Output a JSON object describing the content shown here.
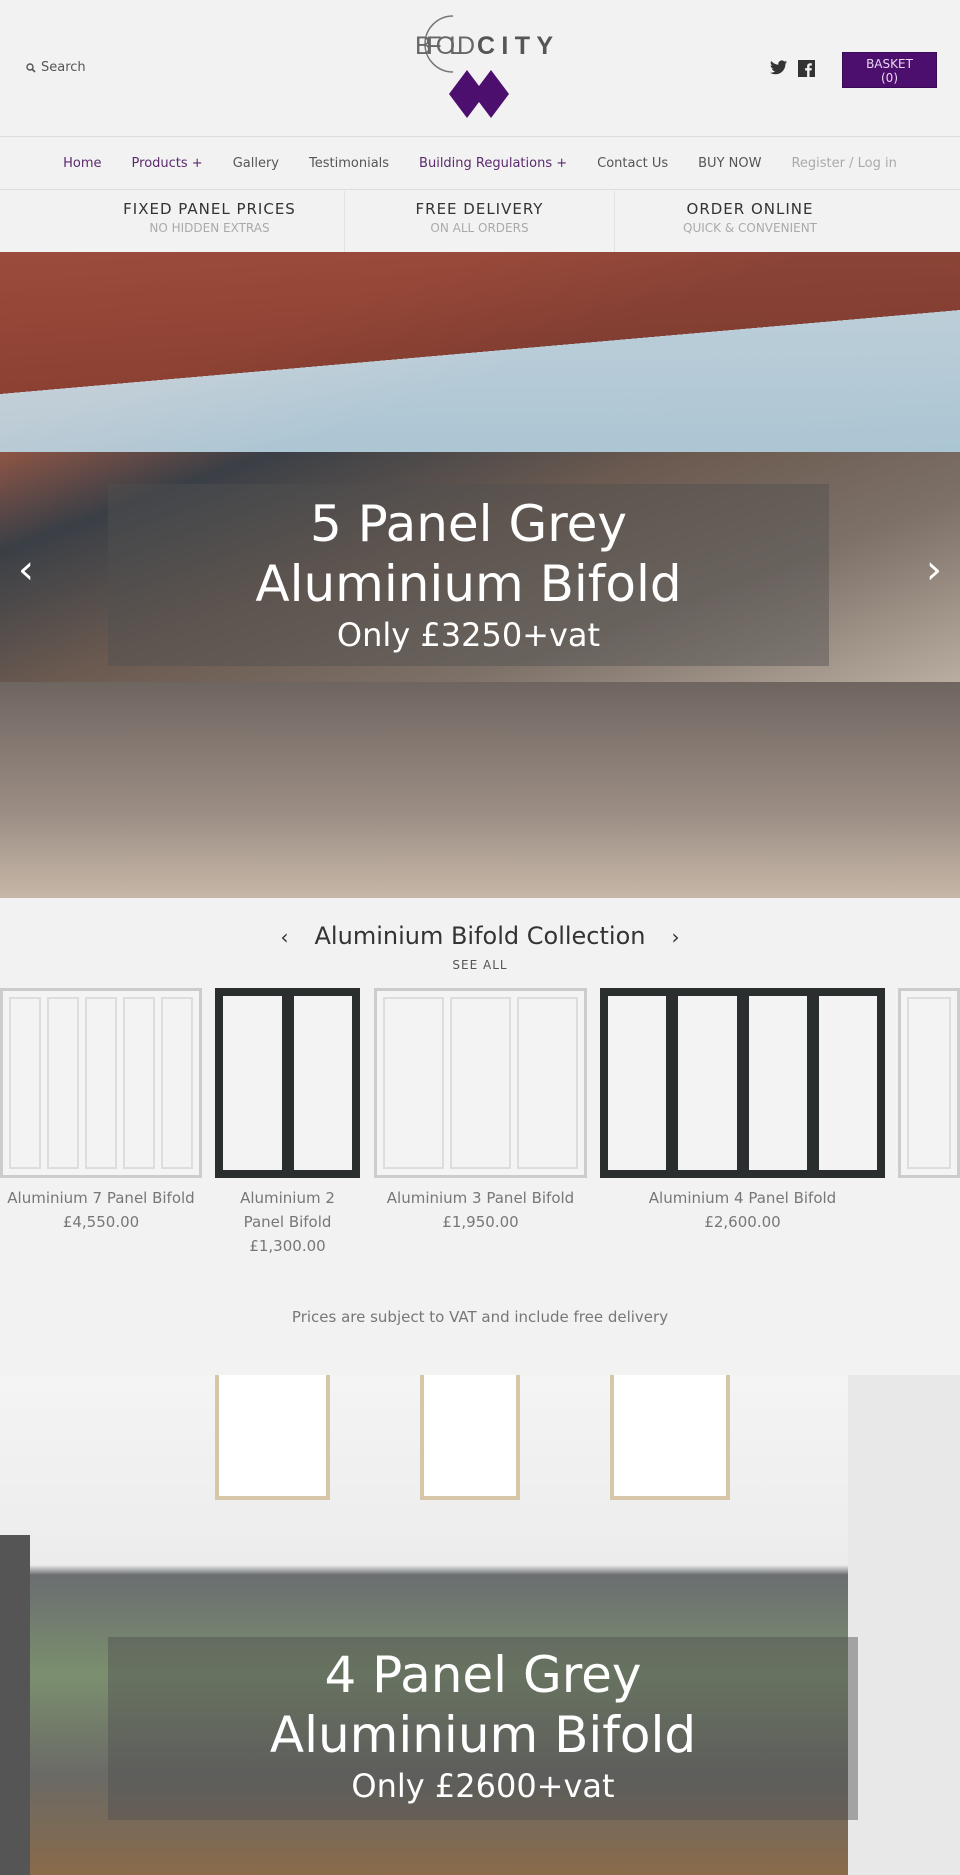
{
  "header": {
    "search_label": "Search",
    "logo_text": "BIFOLDCITY",
    "basket_label": "BASKET",
    "basket_count": "(0)",
    "brand_color": "#4d0f6e",
    "social": [
      "twitter-icon",
      "facebook-icon"
    ]
  },
  "nav": {
    "items": [
      {
        "label": "Home"
      },
      {
        "label": "Products +"
      },
      {
        "label": "Gallery"
      },
      {
        "label": "Testimonials"
      },
      {
        "label": "Building Regulations +"
      },
      {
        "label": "Contact Us"
      },
      {
        "label": "BUY NOW"
      },
      {
        "label": "Register / Log in"
      }
    ]
  },
  "features": [
    {
      "title": "FIXED PANEL PRICES",
      "sub": "NO HIDDEN EXTRAS"
    },
    {
      "title": "FREE DELIVERY",
      "sub": "ON ALL ORDERS"
    },
    {
      "title": "ORDER ONLINE",
      "sub": "QUICK & CONVENIENT"
    }
  ],
  "hero1": {
    "title": "5 Panel Grey Aluminium Bifold",
    "price": "Only £3250+vat"
  },
  "collection": {
    "title": "Aluminium Bifold Collection",
    "see_all": "SEE ALL",
    "prev": "‹",
    "next": "›",
    "products": [
      {
        "name": "Aluminium 7 Panel Bifold",
        "price": "£4,550.00"
      },
      {
        "name": "Aluminium 2 Panel Bifold",
        "price": "£1,300.00"
      },
      {
        "name": "Aluminium 3 Panel Bifold",
        "price": "£1,950.00"
      },
      {
        "name": "Aluminium 4 Panel Bifold",
        "price": "£2,600.00"
      }
    ]
  },
  "disclaimer": "Prices are subject to VAT and include free delivery",
  "hero2": {
    "title": "4 Panel Grey Aluminium Bifold",
    "price": "Only £2600+vat"
  }
}
